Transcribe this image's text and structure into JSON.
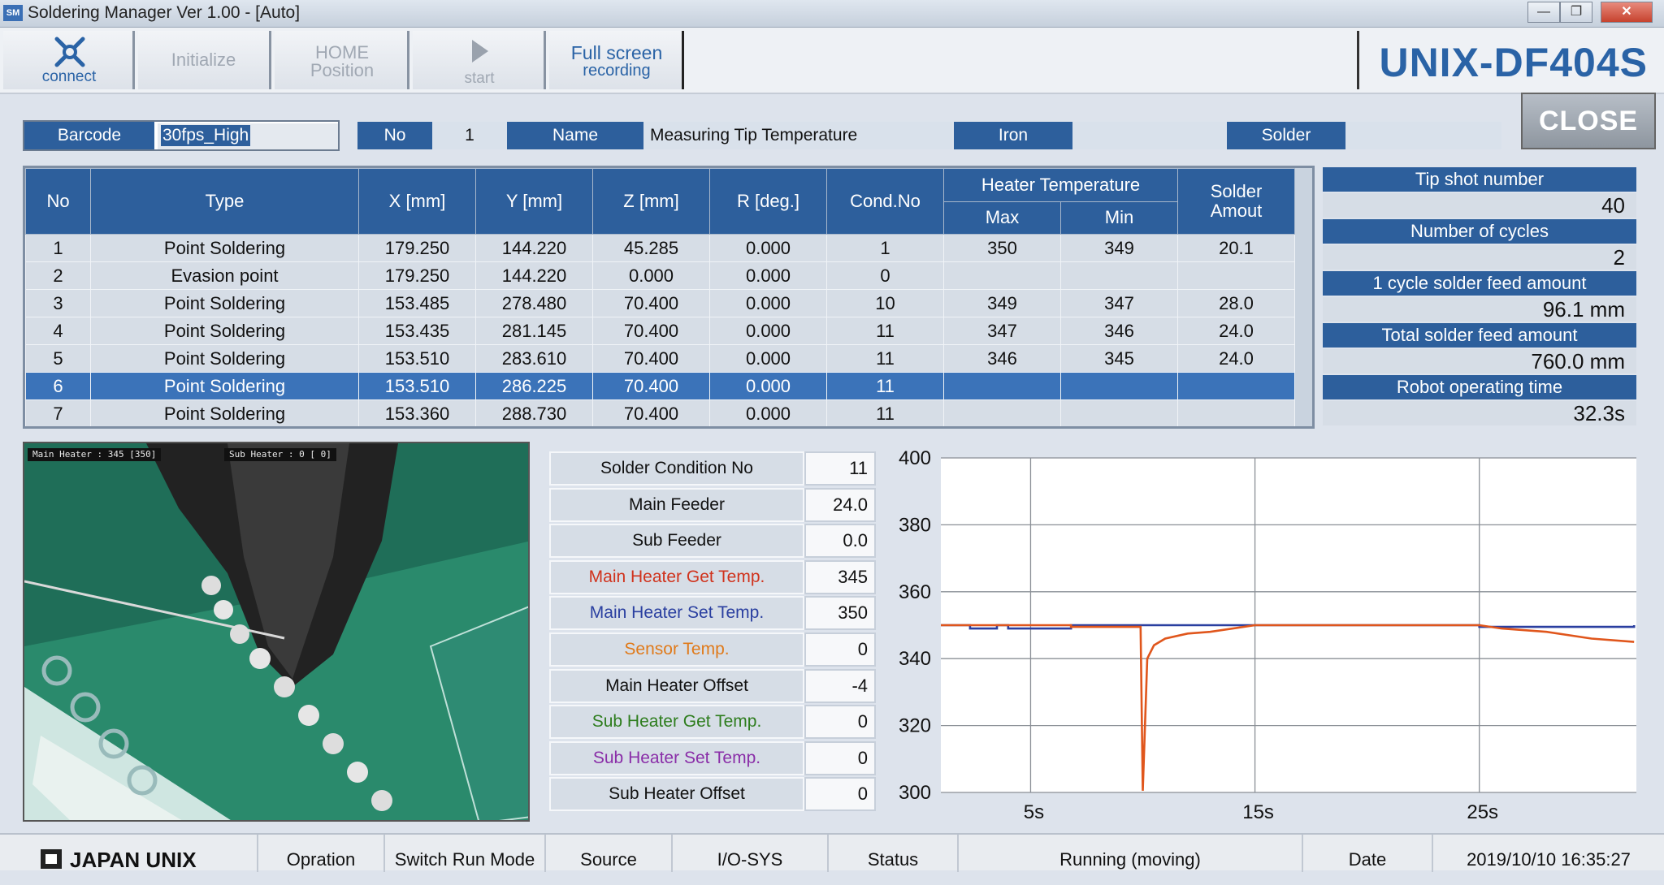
{
  "window": {
    "title": "Soldering Manager Ver 1.00 - [Auto]",
    "app_icon": "SM",
    "minimize_glyph": "—",
    "maximize_glyph": "❐",
    "close_glyph": "✕"
  },
  "toolbar": {
    "connect": "connect",
    "initialize": "Initialize",
    "home_line1": "HOME",
    "home_line2": "Position",
    "start": "start",
    "fullscreen_line1": "Full screen",
    "fullscreen_line2": "recording",
    "brand": "UNIX-DF404S"
  },
  "info": {
    "barcode_label": "Barcode",
    "barcode_value": "30fps_High",
    "no_label": "No",
    "no_value": "1",
    "name_label": "Name",
    "name_value": "Measuring Tip Temperature",
    "iron_label": "Iron",
    "iron_value": "",
    "solder_label": "Solder",
    "solder_value": "",
    "close_label": "CLOSE"
  },
  "table": {
    "headers": {
      "no": "No",
      "type": "Type",
      "x": "X [mm]",
      "y": "Y [mm]",
      "z": "Z [mm]",
      "r": "R [deg.]",
      "cond": "Cond.No",
      "heater": "Heater Temperature",
      "max": "Max",
      "min": "Min",
      "solder_line1": "Solder",
      "solder_line2": "Amout"
    },
    "rows": [
      {
        "no": "1",
        "type": "Point Soldering",
        "x": "179.250",
        "y": "144.220",
        "z": "45.285",
        "r": "0.000",
        "cond": "1",
        "max": "350",
        "min": "349",
        "solder": "20.1"
      },
      {
        "no": "2",
        "type": "Evasion point",
        "x": "179.250",
        "y": "144.220",
        "z": "0.000",
        "r": "0.000",
        "cond": "0",
        "max": "",
        "min": "",
        "solder": ""
      },
      {
        "no": "3",
        "type": "Point Soldering",
        "x": "153.485",
        "y": "278.480",
        "z": "70.400",
        "r": "0.000",
        "cond": "10",
        "max": "349",
        "min": "347",
        "solder": "28.0"
      },
      {
        "no": "4",
        "type": "Point Soldering",
        "x": "153.435",
        "y": "281.145",
        "z": "70.400",
        "r": "0.000",
        "cond": "11",
        "max": "347",
        "min": "346",
        "solder": "24.0"
      },
      {
        "no": "5",
        "type": "Point Soldering",
        "x": "153.510",
        "y": "283.610",
        "z": "70.400",
        "r": "0.000",
        "cond": "11",
        "max": "346",
        "min": "345",
        "solder": "24.0"
      },
      {
        "no": "6",
        "type": "Point Soldering",
        "x": "153.510",
        "y": "286.225",
        "z": "70.400",
        "r": "0.000",
        "cond": "11",
        "max": "",
        "min": "",
        "solder": ""
      },
      {
        "no": "7",
        "type": "Point Soldering",
        "x": "153.360",
        "y": "288.730",
        "z": "70.400",
        "r": "0.000",
        "cond": "11",
        "max": "",
        "min": "",
        "solder": ""
      }
    ],
    "selected_row": "6"
  },
  "stats": {
    "tip_label": "Tip shot number",
    "tip_value": "40",
    "cycles_label": "Number of cycles",
    "cycles_value": "2",
    "feed1_label": "1 cycle solder feed amount",
    "feed1_value": "96.1 mm",
    "total_label": "Total solder feed amount",
    "total_value": "760.0 mm",
    "time_label": "Robot operating time",
    "time_value": "32.3s"
  },
  "camera": {
    "hud_main": "Main Heater : 345 [350]",
    "hud_sub": "Sub Heater :   0 [  0]"
  },
  "params": [
    {
      "label": "Solder Condition No",
      "value": "11",
      "color": "#111111"
    },
    {
      "label": "Main Feeder",
      "value": "24.0",
      "color": "#111111"
    },
    {
      "label": "Sub Feeder",
      "value": "0.0",
      "color": "#111111"
    },
    {
      "label": "Main Heater Get Temp.",
      "value": "345",
      "color": "#d0321c"
    },
    {
      "label": "Main Heater Set Temp.",
      "value": "350",
      "color": "#2a3fa0"
    },
    {
      "label": "Sensor Temp.",
      "value": "0",
      "color": "#e07a1a"
    },
    {
      "label": "Main Heater Offset",
      "value": "-4",
      "color": "#111111"
    },
    {
      "label": "Sub Heater Get Temp.",
      "value": "0",
      "color": "#2e7d1e"
    },
    {
      "label": "Sub Heater Set Temp.",
      "value": "0",
      "color": "#8a2ea8"
    },
    {
      "label": "Sub Heater Offset",
      "value": "0",
      "color": "#111111"
    }
  ],
  "chart_data": {
    "type": "line",
    "ylim": [
      300,
      400
    ],
    "xlim": [
      1,
      32
    ],
    "yticks": [
      "400",
      "380",
      "360",
      "340",
      "320",
      "300"
    ],
    "xticks": [
      {
        "t": 5,
        "label": "5s"
      },
      {
        "t": 15,
        "label": "15s"
      },
      {
        "t": 25,
        "label": "25s"
      }
    ],
    "grid": true,
    "series": [
      {
        "color": "#2a3fa0",
        "points": [
          [
            1,
            350
          ],
          [
            2.3,
            350
          ],
          [
            2.3,
            349
          ],
          [
            3.5,
            349
          ],
          [
            3.5,
            350
          ],
          [
            4,
            350
          ],
          [
            4,
            349
          ],
          [
            6.8,
            349
          ],
          [
            6.8,
            350
          ],
          [
            25,
            350
          ],
          [
            25,
            349.5
          ],
          [
            31.9,
            349.5
          ],
          [
            31.9,
            350
          ]
        ]
      },
      {
        "color": "#e0561c",
        "points": [
          [
            1,
            350
          ],
          [
            6.8,
            350
          ],
          [
            6.8,
            349.5
          ],
          [
            9.9,
            349.5
          ],
          [
            10,
            300.5
          ],
          [
            10.2,
            340
          ],
          [
            10.5,
            344
          ],
          [
            11,
            346
          ],
          [
            12,
            347.5
          ],
          [
            13,
            348
          ],
          [
            15,
            350
          ],
          [
            25,
            350
          ],
          [
            26,
            349
          ],
          [
            28,
            348
          ],
          [
            30,
            346
          ],
          [
            31.9,
            345
          ]
        ]
      }
    ]
  },
  "statusbar": {
    "logo_text": "JAPAN UNIX",
    "opration": "Opration",
    "switch_mode": "Switch Run Mode",
    "source": "Source",
    "io": "I/O-SYS",
    "status_label": "Status",
    "status_value": "Running (moving)",
    "date_label": "Date",
    "date_value": "2019/10/10 16:35:27"
  }
}
